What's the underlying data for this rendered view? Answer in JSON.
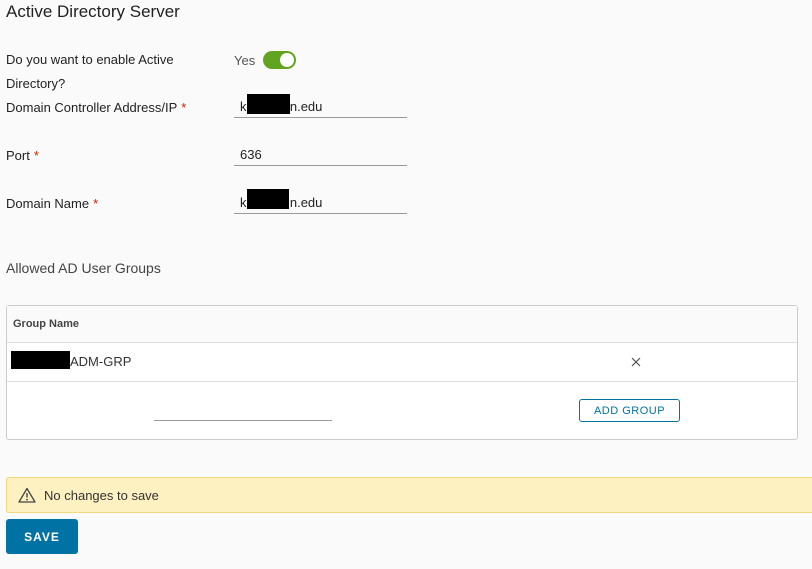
{
  "page": {
    "title": "Active Directory Server"
  },
  "form": {
    "enable_ad": {
      "label_line1": "Do you want to enable Active",
      "label_line2": "Directory?",
      "toggle_text": "Yes",
      "enabled": true
    },
    "domain_controller": {
      "label": "Domain Controller Address/IP",
      "required_mark": "*",
      "value": "k          nn.edu"
    },
    "port": {
      "label": "Port",
      "required_mark": "*",
      "value": "636"
    },
    "domain_name": {
      "label": "Domain Name",
      "required_mark": "*",
      "value": "k          nn.edu"
    }
  },
  "groups": {
    "section_title": "Allowed AD User Groups",
    "column_header": "Group Name",
    "rows": [
      {
        "name": "ADM-GRP"
      }
    ],
    "new_group_value": "",
    "add_button_label": "ADD GROUP"
  },
  "alert": {
    "icon": "warning-triangle-icon",
    "text": "No changes to save"
  },
  "actions": {
    "save_label": "SAVE"
  },
  "colors": {
    "accent": "#0072a3",
    "toggle_on": "#62a420",
    "required": "#c92100",
    "alert_bg": "#fdf1c2"
  }
}
